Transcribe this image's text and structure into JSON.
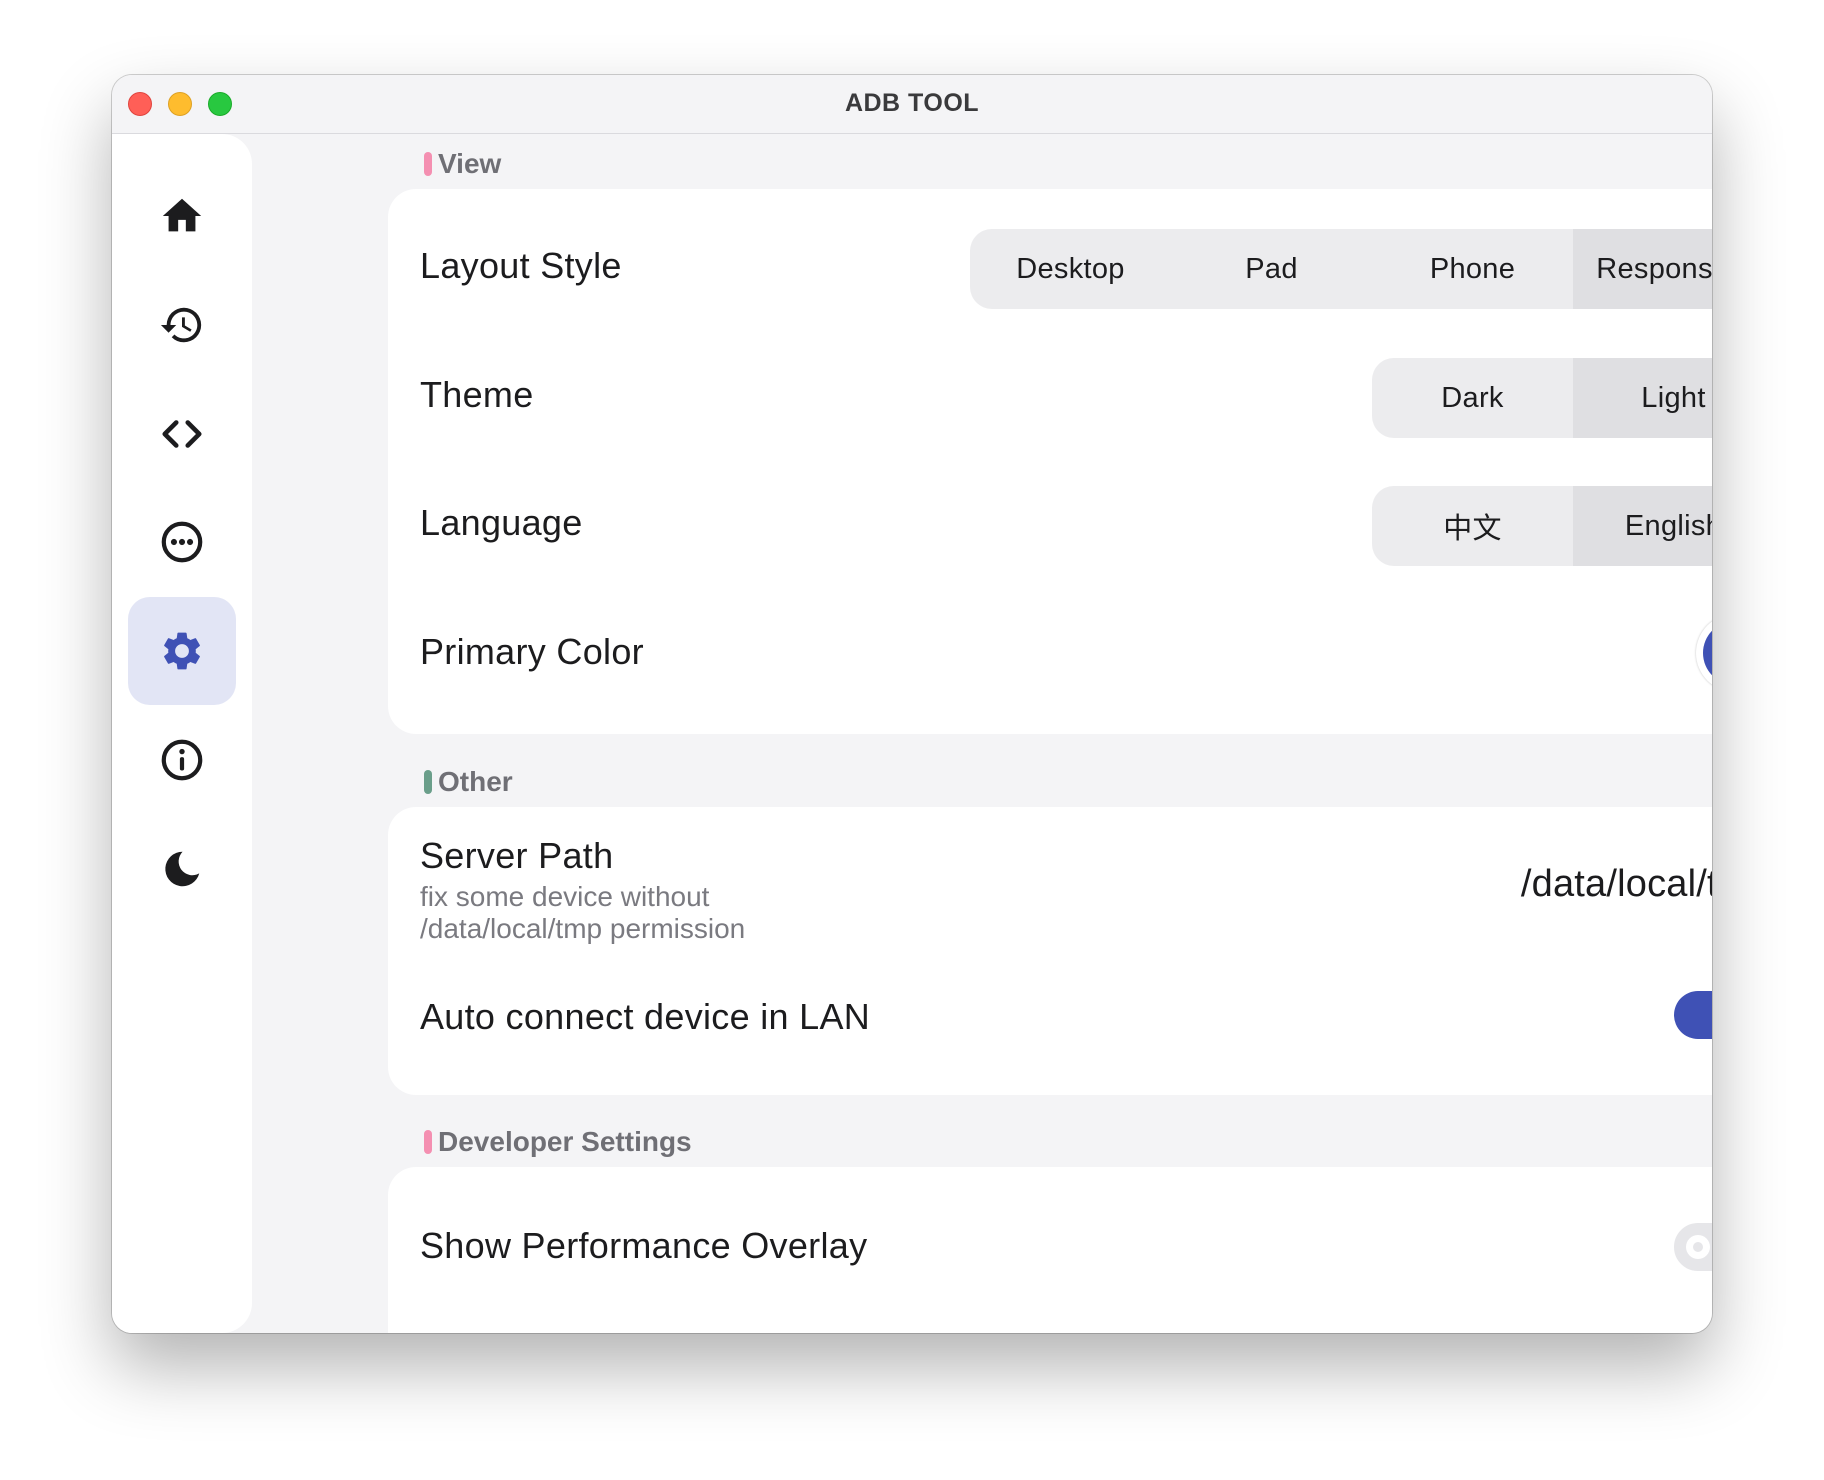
{
  "window": {
    "title": "ADB TOOL"
  },
  "sidebar": {
    "items": [
      {
        "icon": "home-icon",
        "active": false
      },
      {
        "icon": "history-icon",
        "active": false
      },
      {
        "icon": "code-icon",
        "active": false
      },
      {
        "icon": "more-icon",
        "active": false
      },
      {
        "icon": "gear-icon",
        "active": true
      },
      {
        "icon": "info-icon",
        "active": false
      },
      {
        "icon": "moon-icon",
        "active": false
      }
    ]
  },
  "sections": {
    "view": {
      "title": "View",
      "accent": "#f48fb1",
      "layout_style": {
        "label": "Layout Style",
        "options": [
          "Desktop",
          "Pad",
          "Phone",
          "Responsive"
        ],
        "selected": "Responsive"
      },
      "theme": {
        "label": "Theme",
        "options": [
          "Dark",
          "Light"
        ],
        "selected": "Light"
      },
      "language": {
        "label": "Language",
        "options": [
          "中文",
          "English"
        ],
        "selected": "English"
      },
      "primary_color": {
        "label": "Primary Color",
        "value": "#3f51b5"
      }
    },
    "other": {
      "title": "Other",
      "accent": "#6a9e8a",
      "server_path": {
        "label": "Server Path",
        "description": "fix some device without /data/local/tmp permission",
        "value": "/data/local/tmp"
      },
      "auto_connect": {
        "label": "Auto connect device in LAN",
        "enabled": true
      }
    },
    "developer": {
      "title": "Developer Settings",
      "accent": "#f48fb1",
      "performance_overlay": {
        "label": "Show Performance Overlay",
        "enabled": false
      }
    }
  }
}
